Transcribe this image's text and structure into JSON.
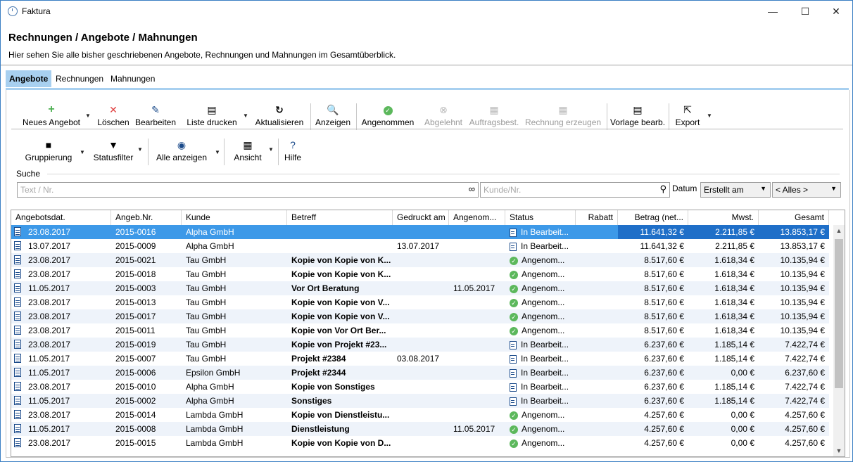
{
  "window": {
    "title": "Faktura",
    "min": "—",
    "max": "☐",
    "close": "✕"
  },
  "page": {
    "title": "Rechnungen / Angebote / Mahnungen",
    "subtitle": "Hier sehen Sie alle bisher geschriebenen Angebote, Rechnungen und Mahnungen im Gesamtüberblick."
  },
  "tabs": [
    {
      "label": "Angebote"
    },
    {
      "label": "Rechnungen"
    },
    {
      "label": "Mahnungen"
    }
  ],
  "toolbar": {
    "neues_angebot": "Neues Angebot",
    "loeschen": "Löschen",
    "bearbeiten": "Bearbeiten",
    "liste_drucken": "Liste drucken",
    "aktualisieren": "Aktualisieren",
    "anzeigen": "Anzeigen",
    "angenommen": "Angenommen",
    "abgelehnt": "Abgelehnt",
    "auftragsbest": "Auftragsbest.",
    "rechnung_erzeugen": "Rechnung erzeugen",
    "vorlage_bearb": "Vorlage bearb.",
    "export": "Export",
    "gruppierung": "Gruppierung",
    "statusfilter": "Statusfilter",
    "alle_anzeigen": "Alle anzeigen",
    "ansicht": "Ansicht",
    "hilfe": "Hilfe"
  },
  "search": {
    "label": "Suche",
    "text_placeholder": "Text / Nr.",
    "kunde_placeholder": "Kunde/Nr.",
    "datum_label": "Datum",
    "datum_value": "Erstellt am",
    "range_value": "< Alles >"
  },
  "grid": {
    "headers": [
      "Angebotsdat.",
      "Angeb.Nr.",
      "Kunde",
      "Betreff",
      "Gedruckt am",
      "Angenom...",
      "Status",
      "Rabatt",
      "Betrag (net...",
      "Mwst.",
      "Gesamt"
    ],
    "rows": [
      {
        "datum": "23.08.2017",
        "nr": "2015-0016",
        "kunde": "Alpha GmbH",
        "betreff": "",
        "gedruckt": "",
        "angenommen": "",
        "status": "In Bearbeit...",
        "status_type": "edit",
        "rabatt": "",
        "betrag": "11.641,32 €",
        "mwst": "2.211,85 €",
        "gesamt": "13.853,17 €"
      },
      {
        "datum": "13.07.2017",
        "nr": "2015-0009",
        "kunde": "Alpha GmbH",
        "betreff": "",
        "gedruckt": "13.07.2017",
        "angenommen": "",
        "status": "In Bearbeit...",
        "status_type": "edit",
        "rabatt": "",
        "betrag": "11.641,32 €",
        "mwst": "2.211,85 €",
        "gesamt": "13.853,17 €"
      },
      {
        "datum": "23.08.2017",
        "nr": "2015-0021",
        "kunde": "Tau GmbH",
        "betreff": "Kopie von Kopie von K...",
        "gedruckt": "",
        "angenommen": "",
        "status": "Angenom...",
        "status_type": "ok",
        "rabatt": "",
        "betrag": "8.517,60 €",
        "mwst": "1.618,34 €",
        "gesamt": "10.135,94 €"
      },
      {
        "datum": "23.08.2017",
        "nr": "2015-0018",
        "kunde": "Tau GmbH",
        "betreff": "Kopie von Kopie von K...",
        "gedruckt": "",
        "angenommen": "",
        "status": "Angenom...",
        "status_type": "ok",
        "rabatt": "",
        "betrag": "8.517,60 €",
        "mwst": "1.618,34 €",
        "gesamt": "10.135,94 €"
      },
      {
        "datum": "11.05.2017",
        "nr": "2015-0003",
        "kunde": "Tau GmbH",
        "betreff": "Vor Ort Beratung",
        "gedruckt": "",
        "angenommen": "11.05.2017",
        "status": "Angenom...",
        "status_type": "ok",
        "rabatt": "",
        "betrag": "8.517,60 €",
        "mwst": "1.618,34 €",
        "gesamt": "10.135,94 €"
      },
      {
        "datum": "23.08.2017",
        "nr": "2015-0013",
        "kunde": "Tau GmbH",
        "betreff": "Kopie von Kopie von V...",
        "gedruckt": "",
        "angenommen": "",
        "status": "Angenom...",
        "status_type": "ok",
        "rabatt": "",
        "betrag": "8.517,60 €",
        "mwst": "1.618,34 €",
        "gesamt": "10.135,94 €"
      },
      {
        "datum": "23.08.2017",
        "nr": "2015-0017",
        "kunde": "Tau GmbH",
        "betreff": "Kopie von Kopie von V...",
        "gedruckt": "",
        "angenommen": "",
        "status": "Angenom...",
        "status_type": "ok",
        "rabatt": "",
        "betrag": "8.517,60 €",
        "mwst": "1.618,34 €",
        "gesamt": "10.135,94 €"
      },
      {
        "datum": "23.08.2017",
        "nr": "2015-0011",
        "kunde": "Tau GmbH",
        "betreff": "Kopie von Vor Ort Ber...",
        "gedruckt": "",
        "angenommen": "",
        "status": "Angenom...",
        "status_type": "ok",
        "rabatt": "",
        "betrag": "8.517,60 €",
        "mwst": "1.618,34 €",
        "gesamt": "10.135,94 €"
      },
      {
        "datum": "23.08.2017",
        "nr": "2015-0019",
        "kunde": "Tau GmbH",
        "betreff": "Kopie von Projekt #23...",
        "gedruckt": "",
        "angenommen": "",
        "status": "In Bearbeit...",
        "status_type": "edit",
        "rabatt": "",
        "betrag": "6.237,60 €",
        "mwst": "1.185,14 €",
        "gesamt": "7.422,74 €"
      },
      {
        "datum": "11.05.2017",
        "nr": "2015-0007",
        "kunde": "Tau GmbH",
        "betreff": "Projekt #2384",
        "gedruckt": "03.08.2017",
        "angenommen": "",
        "status": "In Bearbeit...",
        "status_type": "edit",
        "rabatt": "",
        "betrag": "6.237,60 €",
        "mwst": "1.185,14 €",
        "gesamt": "7.422,74 €"
      },
      {
        "datum": "11.05.2017",
        "nr": "2015-0006",
        "kunde": "Epsilon GmbH",
        "betreff": "Projekt #2344",
        "gedruckt": "",
        "angenommen": "",
        "status": "In Bearbeit...",
        "status_type": "edit",
        "rabatt": "",
        "betrag": "6.237,60 €",
        "mwst": "0,00 €",
        "gesamt": "6.237,60 €"
      },
      {
        "datum": "23.08.2017",
        "nr": "2015-0010",
        "kunde": "Alpha GmbH",
        "betreff": "Kopie von Sonstiges",
        "gedruckt": "",
        "angenommen": "",
        "status": "In Bearbeit...",
        "status_type": "edit",
        "rabatt": "",
        "betrag": "6.237,60 €",
        "mwst": "1.185,14 €",
        "gesamt": "7.422,74 €"
      },
      {
        "datum": "11.05.2017",
        "nr": "2015-0002",
        "kunde": "Alpha GmbH",
        "betreff": "Sonstiges",
        "gedruckt": "",
        "angenommen": "",
        "status": "In Bearbeit...",
        "status_type": "edit",
        "rabatt": "",
        "betrag": "6.237,60 €",
        "mwst": "1.185,14 €",
        "gesamt": "7.422,74 €"
      },
      {
        "datum": "23.08.2017",
        "nr": "2015-0014",
        "kunde": "Lambda GmbH",
        "betreff": "Kopie von Dienstleistu...",
        "gedruckt": "",
        "angenommen": "",
        "status": "Angenom...",
        "status_type": "ok",
        "rabatt": "",
        "betrag": "4.257,60 €",
        "mwst": "0,00 €",
        "gesamt": "4.257,60 €"
      },
      {
        "datum": "11.05.2017",
        "nr": "2015-0008",
        "kunde": "Lambda GmbH",
        "betreff": "Dienstleistung",
        "gedruckt": "",
        "angenommen": "11.05.2017",
        "status": "Angenom...",
        "status_type": "ok",
        "rabatt": "",
        "betrag": "4.257,60 €",
        "mwst": "0,00 €",
        "gesamt": "4.257,60 €"
      },
      {
        "datum": "23.08.2017",
        "nr": "2015-0015",
        "kunde": "Lambda GmbH",
        "betreff": "Kopie von Kopie von D...",
        "gedruckt": "",
        "angenommen": "",
        "status": "Angenom...",
        "status_type": "ok",
        "rabatt": "",
        "betrag": "4.257,60 €",
        "mwst": "0,00 €",
        "gesamt": "4.257,60 €"
      }
    ]
  },
  "colors": {
    "selection": "#3d99e8",
    "tab_active": "#a8d0f0",
    "status_ok": "#5cb85c"
  }
}
